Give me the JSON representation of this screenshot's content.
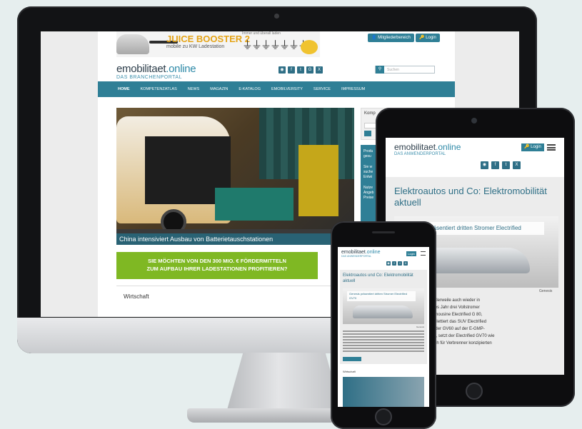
{
  "desktop": {
    "banner": {
      "title": "JUICE BOOSTER 2",
      "subtitle": "mobile zu KW Ladestation",
      "tagline": "Immer und überall laden"
    },
    "header": {
      "members_label": "Mitgliederbereich",
      "login_label": "Login",
      "brand_main": "emobilitaet",
      "brand_tld": ".online",
      "brand_tagline": "DAS BRANCHENPORTAL",
      "search_placeholder": "Suchen",
      "social": [
        "rss-icon",
        "facebook-icon",
        "twitter-icon",
        "googleplus-icon",
        "xing-icon"
      ]
    },
    "nav": [
      {
        "label": "HOME",
        "active": true
      },
      {
        "label": "KOMPETENZATLAS"
      },
      {
        "label": "NEWS"
      },
      {
        "label": "MAGAZIN"
      },
      {
        "label": "E-KATALOG"
      },
      {
        "label": "EMOBILVERSITY"
      },
      {
        "label": "SERVICE"
      },
      {
        "label": "IMPRESSUM"
      }
    ],
    "hero": {
      "caption": "China intensiviert Ausbau von Batterietauschstationen"
    },
    "cta": {
      "line1": "SIE MÖCHTEN VON DEN 300 MIO. € FÖRDERMITTELN",
      "line2": "ZUM AUFBAU IHRER LADESTATIONEN PROFITIEREN?"
    },
    "section_title": "Wirtschaft",
    "sidebar": {
      "widget_title": "Komp",
      "panel_lines": [
        "Produ",
        "gesu",
        "Sie w",
        "suche",
        "Entwi",
        "Nutze",
        "Angeb",
        "Preise"
      ]
    }
  },
  "tablet": {
    "login_label": "Login",
    "brand_main": "emobilitaet",
    "brand_tld": ".online",
    "brand_tagline": "DAS ANWENDERPORTAL",
    "headline": "Elektroautos und Co: Elektromobilität aktuell",
    "image_caption": "Genesis präsentiert dritten Stromer Electrified",
    "credit": "Genesis",
    "text_lines": [
      "ochter Genesis ist mittlerweile auch wieder in",
      "reten und hat für dieses Jahr drei Vollstromer",
      "Anfang machte die Limousine Electrified G 80,",
      "over GV60. Nun komplettiert das SUV Electrified",
      "chene Trio. Während der GV60 auf der E-GMP-",
      "ndai-Konzerns basiert, setzt der Electrified GV70 wie",
      "0 auf einer ursprünglich für Verbrenner konzipierten"
    ]
  },
  "phone": {
    "login_label": "Login",
    "brand_main": "emobilitaet",
    "brand_tld": ".online",
    "brand_tagline": "DAS ANWENDERPORTAL",
    "headline": "Elektroautos und Co: Elektromobilität aktuell",
    "image_caption": "Genesis präsentiert dritten Stromer Electrified GV70",
    "credit": "Genesis",
    "section_title": "Wirtschaft"
  }
}
